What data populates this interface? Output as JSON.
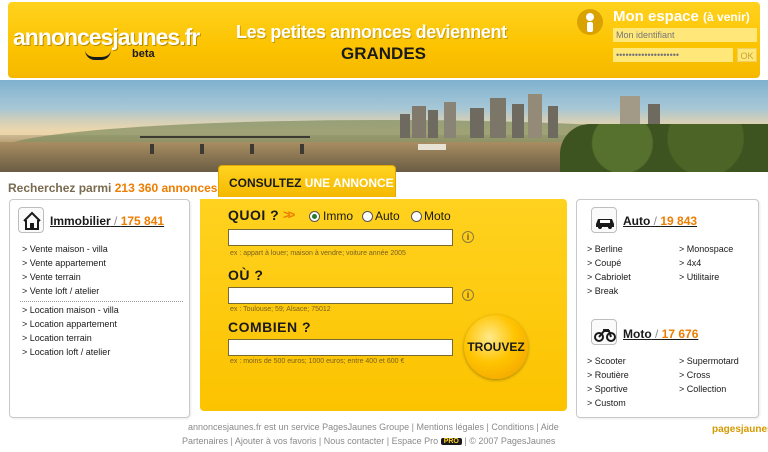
{
  "header": {
    "logo_text": "annoncesjaunes.fr",
    "logo_beta": "beta",
    "tagline_line1": "Les petites annonces deviennent",
    "tagline_line2": "GRANDES",
    "espace_title": "Mon espace",
    "espace_note": "(à venir)",
    "identifier_placeholder": "Mon identifiant",
    "password_placeholder": "••••••••••••••••••••",
    "ok_label": "OK"
  },
  "search_count": {
    "prefix": "Recherchez parmi",
    "count": "213 360 annonces"
  },
  "tab": {
    "label_dark": "CONSULTEZ",
    "label_light": "UNE ANNONCE"
  },
  "immobilier": {
    "title": "Immobilier",
    "count": "175 841",
    "vente": [
      "Vente maison - villa",
      "Vente appartement",
      "Vente terrain",
      "Vente loft / atelier"
    ],
    "location": [
      "Location maison - villa",
      "Location appartement",
      "Location terrain",
      "Location loft / atelier"
    ]
  },
  "search_form": {
    "quoi_label": "QUOI ?",
    "radios": [
      "Immo",
      "Auto",
      "Moto"
    ],
    "selected_radio": "Immo",
    "quoi_hint": "ex : appart à louer; maison à vendre; voiture année 2005",
    "ou_label": "OÙ ?",
    "ou_hint": "ex : Toulouse; 59; Alsace; 75012",
    "combien_label": "COMBIEN ?",
    "combien_hint": "ex : moins de 500 euros; 1000 euros; entre 400 et 600 €",
    "quoi_value": "",
    "ou_value": "",
    "combien_value": "",
    "submit_label": "TROUVEZ",
    "info_glyph": "i"
  },
  "auto": {
    "title": "Auto",
    "count": "19 843",
    "col1": [
      "Berline",
      "Coupé",
      "Cabriolet",
      "Break"
    ],
    "col2": [
      "Monospace",
      "4x4",
      "Utilitaire"
    ]
  },
  "moto": {
    "title": "Moto",
    "count": "17 676",
    "col1": [
      "Scooter",
      "Routière",
      "Sportive",
      "Custom"
    ],
    "col2": [
      "Supermotard",
      "Cross",
      "Collection"
    ]
  },
  "footer": {
    "line1": [
      "annoncesjaunes.fr est un service PagesJaunes Groupe",
      "Mentions légales",
      "Conditions",
      "Aide"
    ],
    "line2": [
      "Partenaires",
      "Ajouter à vos favoris",
      "Nous contacter",
      "Espace Pro",
      "© 2007 PagesJaunes"
    ],
    "pro_badge": "PRO",
    "brand": "pagesjaunes"
  },
  "colors": {
    "yellow": "#fcc300",
    "orange": "#ee7d00",
    "dark": "#1a1a1a"
  }
}
